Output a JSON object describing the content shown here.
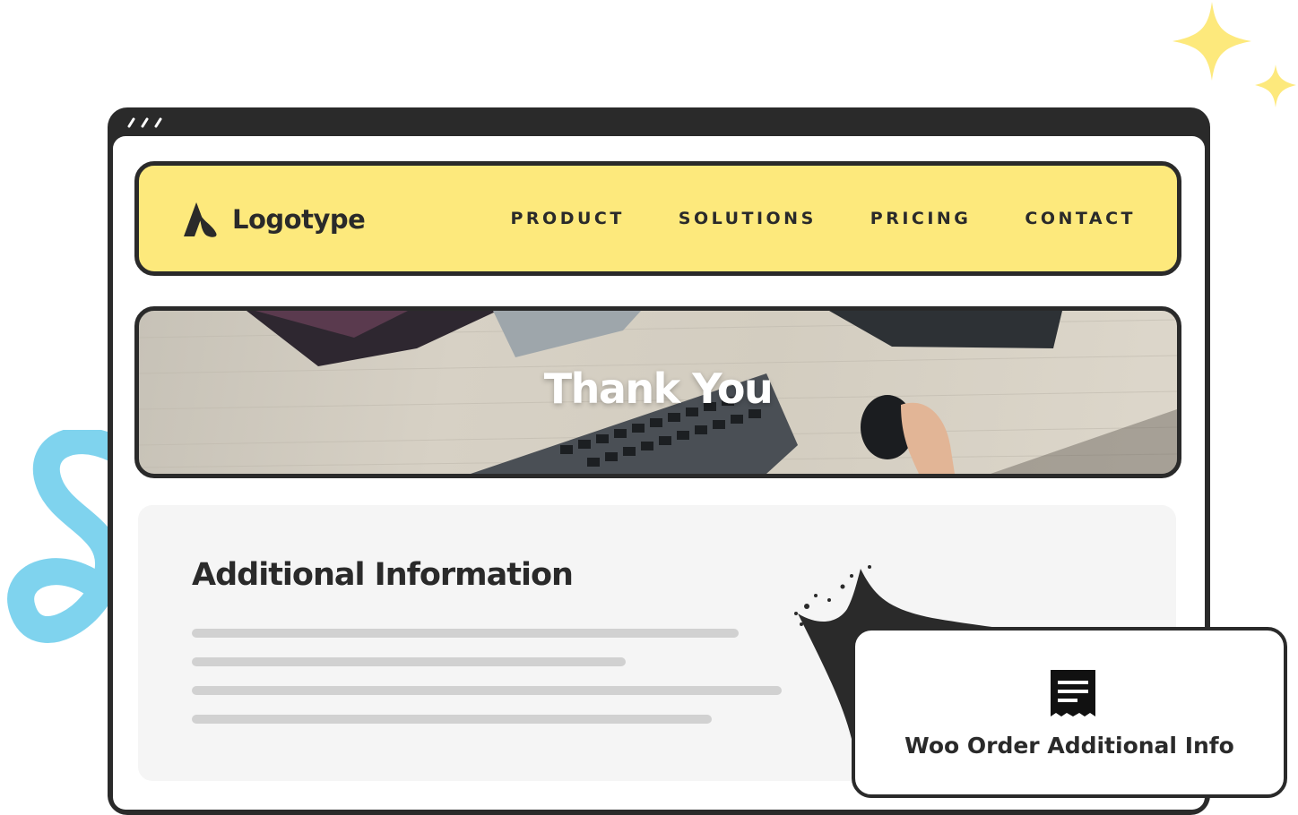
{
  "navbar": {
    "logo_text": "Logotype",
    "items": [
      {
        "label": "PRODUCT"
      },
      {
        "label": "SOLUTIONS"
      },
      {
        "label": "PRICING"
      },
      {
        "label": "CONTACT"
      }
    ]
  },
  "hero": {
    "title": "Thank You"
  },
  "content": {
    "title": "Additional Information"
  },
  "badge": {
    "label": "Woo Order Additional Info",
    "icon": "receipt-icon"
  },
  "colors": {
    "accent_yellow": "#fde97c",
    "frame_dark": "#2a2a2a",
    "squiggle_blue": "#7fd3ee",
    "sparkle_yellow": "#fde97c",
    "panel_gray": "#f5f5f5",
    "placeholder_line": "#d1d1d1"
  }
}
